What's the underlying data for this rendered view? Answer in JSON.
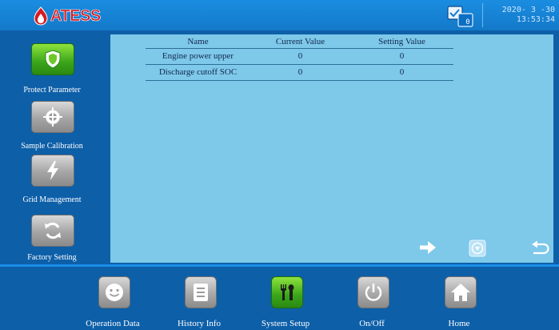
{
  "header": {
    "logo_text": "ATESS",
    "message_count": "0",
    "date": "2020- 3 -30",
    "time": "13:53:34"
  },
  "sidebar": {
    "items": [
      {
        "label": "Protect Parameter",
        "icon": "shield-icon",
        "active": true
      },
      {
        "label": "Sample Calibration",
        "icon": "target-icon",
        "active": false
      },
      {
        "label": "Grid Management",
        "icon": "lightning-icon",
        "active": false
      },
      {
        "label": "Factory Setting",
        "icon": "refresh-icon",
        "active": false
      }
    ]
  },
  "table": {
    "headers": [
      "Name",
      "Current Value",
      "Setting Value"
    ],
    "rows": [
      {
        "name": "Engine power upper",
        "current": "0",
        "setting": "0"
      },
      {
        "name": "Discharge cutoff SOC",
        "current": "0",
        "setting": "0"
      }
    ]
  },
  "controls": {
    "next_icon": "arrow-right-icon",
    "download_icon": "download-icon",
    "back_icon": "return-icon"
  },
  "bottom_nav": {
    "items": [
      {
        "label": "Operation Data",
        "icon": "smiley-icon",
        "active": false
      },
      {
        "label": "History Info",
        "icon": "list-icon",
        "active": false
      },
      {
        "label": "System Setup",
        "icon": "tools-icon",
        "active": true
      },
      {
        "label": "On/Off",
        "icon": "power-icon",
        "active": false
      },
      {
        "label": "Home",
        "icon": "home-icon",
        "active": false
      }
    ]
  },
  "colors": {
    "brand": "#d71a21",
    "header_blue": "#1479c9",
    "panel": "#7ec8ea",
    "active_green": "#3aa51a"
  }
}
